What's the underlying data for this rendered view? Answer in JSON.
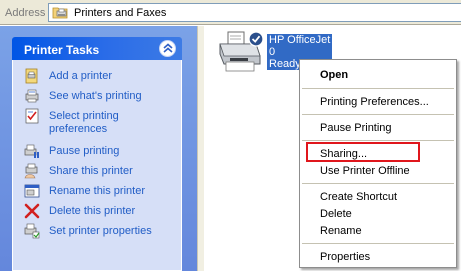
{
  "address_bar": {
    "label": "Address",
    "value": "Printers and Faxes",
    "icon": "printers-folder-icon"
  },
  "task_pane": {
    "title": "Printer Tasks",
    "collapse_icon": "double-chevron-up-icon",
    "tasks": [
      {
        "label": "Add a printer",
        "icon": "add-printer-icon"
      },
      {
        "label": "See what's printing",
        "icon": "printer-queue-icon"
      },
      {
        "label": "Select printing preferences",
        "icon": "preferences-icon"
      },
      {
        "label": "Pause printing",
        "icon": "pause-printer-icon"
      },
      {
        "label": "Share this printer",
        "icon": "share-printer-icon"
      },
      {
        "label": "Rename this printer",
        "icon": "rename-icon"
      },
      {
        "label": "Delete this printer",
        "icon": "delete-x-icon"
      },
      {
        "label": "Set printer properties",
        "icon": "properties-icon"
      }
    ]
  },
  "printer": {
    "name": "HP OfficeJet",
    "documents": "0",
    "status": "Ready",
    "icon": "default-printer-icon"
  },
  "context_menu": {
    "items": [
      {
        "label": "Open",
        "bold": true
      },
      {
        "label": "Printing Preferences..."
      },
      {
        "label": "Pause Printing"
      },
      {
        "label": "Sharing..."
      },
      {
        "label": "Use Printer Offline"
      },
      {
        "label": "Create Shortcut"
      },
      {
        "label": "Delete"
      },
      {
        "label": "Rename"
      },
      {
        "label": "Properties"
      }
    ],
    "highlighted_item": "Sharing..."
  },
  "colors": {
    "task_header": "#0055e5",
    "task_link": "#215dc6",
    "selection": "#316ac5",
    "highlight_box": "#e0161c"
  }
}
